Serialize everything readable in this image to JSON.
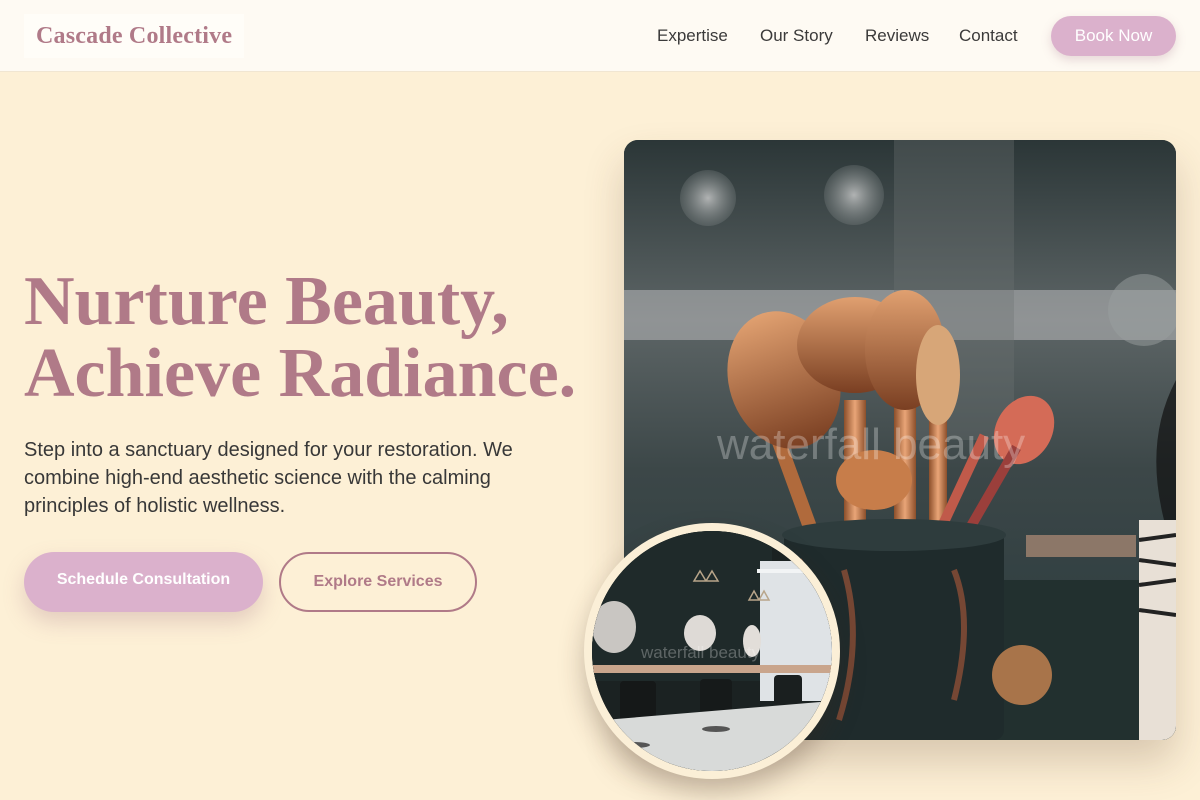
{
  "header": {
    "logo": "Cascade Collective",
    "nav": [
      "Expertise",
      "Our Story",
      "Reviews",
      "Contact"
    ],
    "cta": "Book Now"
  },
  "hero": {
    "headline_line1": "Nurture Beauty,",
    "headline_line2": "Achieve Radiance.",
    "subtext": "Step into a sanctuary designed for your restoration. We combine high-end aesthetic science with the calming principles of holistic wellness.",
    "primary_button": "Schedule Consultation",
    "secondary_button": "Explore Services"
  },
  "images": {
    "main_image": "makeup-brushes-photo",
    "main_watermark": "waterfall beauty",
    "inset_image": "salon-interior-photo",
    "inset_watermark": "waterfall beauty"
  },
  "colors": {
    "background": "#fdf0d6",
    "header_bg": "#fefaf3",
    "accent_rose": "#b07a88",
    "button_pink": "#dbb1cc",
    "body_text": "#383838"
  }
}
